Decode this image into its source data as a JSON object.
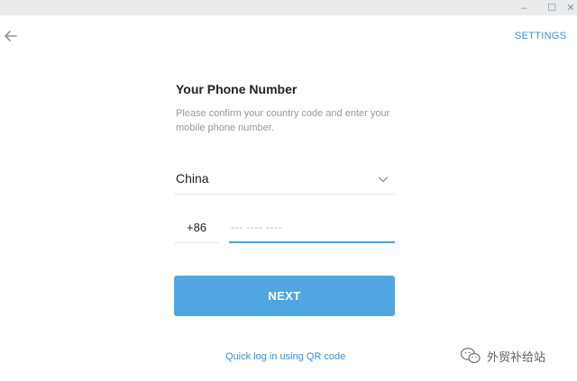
{
  "window": {
    "minimize_glyph": "–",
    "maximize_glyph": "☐",
    "close_glyph": "✕"
  },
  "header": {
    "back_icon": "arrow-left-icon",
    "settings_label": "SETTINGS"
  },
  "form": {
    "title": "Your Phone Number",
    "description": "Please confirm your country code and enter your mobile phone number.",
    "country": {
      "selected": "China",
      "icon": "chevron-down-icon"
    },
    "country_code": "+86",
    "phone": {
      "value": "",
      "placeholder": "--- ---- ----"
    },
    "next_label": "NEXT",
    "qr_link_label": "Quick log in using QR code"
  },
  "watermark": {
    "text": "外贸补给站",
    "icon": "wechat-icon"
  },
  "colors": {
    "accent": "#50a6e0",
    "link": "#3d8ec9",
    "muted_text": "#999999",
    "titlebar": "#e9ebed"
  }
}
